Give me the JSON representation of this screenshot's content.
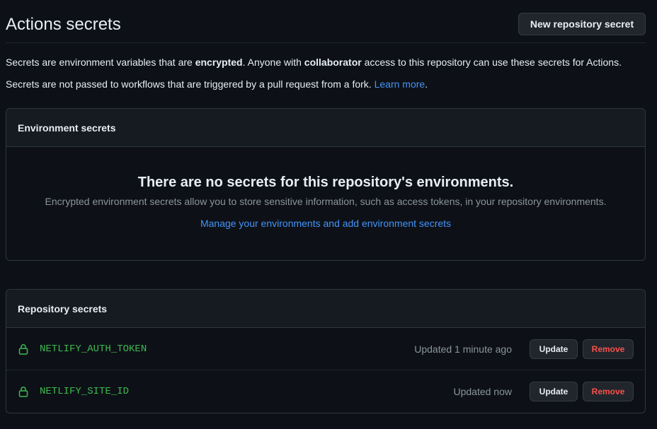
{
  "header": {
    "title": "Actions secrets",
    "new_button_label": "New repository secret"
  },
  "description": {
    "line1_part1": "Secrets are environment variables that are ",
    "line1_bold1": "encrypted",
    "line1_part2": ". Anyone with ",
    "line1_bold2": "collaborator",
    "line1_part3": " access to this repository can use these secrets for Actions.",
    "line2_text": "Secrets are not passed to workflows that are triggered by a pull request from a fork. ",
    "line2_link": "Learn more",
    "line2_end": "."
  },
  "environment_secrets": {
    "header": "Environment secrets",
    "blank_title": "There are no secrets for this repository's environments.",
    "blank_description": "Encrypted environment secrets allow you to store sensitive information, such as access tokens, in your repository environments.",
    "blank_link": "Manage your environments and add environment secrets"
  },
  "repository_secrets": {
    "header": "Repository secrets",
    "items": [
      {
        "icon": "lock-icon",
        "name": "NETLIFY_AUTH_TOKEN",
        "updated": "Updated 1 minute ago",
        "update_label": "Update",
        "remove_label": "Remove"
      },
      {
        "icon": "lock-icon",
        "name": "NETLIFY_SITE_ID",
        "updated": "Updated now",
        "update_label": "Update",
        "remove_label": "Remove"
      }
    ]
  },
  "colors": {
    "background": "#0d1117",
    "link": "#4493f8",
    "secret_name": "#3fb950",
    "danger": "#f85149",
    "muted": "#8b949e"
  }
}
